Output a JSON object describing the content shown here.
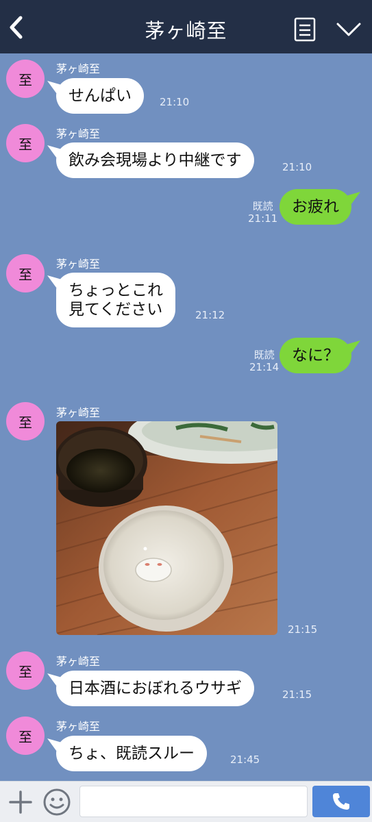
{
  "header": {
    "title": "茅ヶ崎至"
  },
  "messages": [
    {
      "avatar": "至",
      "name": "茅ヶ崎至",
      "text": "せんぱい",
      "time": "21:10"
    },
    {
      "avatar": "至",
      "name": "茅ヶ崎至",
      "text": "飲み会現場より中継です",
      "time": "21:10"
    },
    {
      "read": "既読",
      "text": "お疲れ",
      "time": "21:11"
    },
    {
      "avatar": "至",
      "name": "茅ヶ崎至",
      "text": "ちょっとこれ\n見てください",
      "time": "21:12"
    },
    {
      "read": "既読",
      "text": "なに？",
      "time": "21:14"
    },
    {
      "avatar": "至",
      "name": "茅ヶ崎至",
      "time": "21:15"
    },
    {
      "avatar": "至",
      "name": "茅ヶ崎至",
      "text": "日本酒におぼれるウサギ",
      "time": "21:15"
    },
    {
      "avatar": "至",
      "name": "茅ヶ崎至",
      "text": "ちょ、既読スルー",
      "time": "21:45"
    }
  ],
  "input": {
    "placeholder": ""
  },
  "colors": {
    "header_bg": "#232f46",
    "chat_bg": "#7190c0",
    "sent_bubble": "#7fd63a",
    "avatar": "#f08ad9",
    "send_button": "#4f85d8"
  },
  "icons": [
    "back-icon",
    "note-icon",
    "chevron-down-icon",
    "plus-icon",
    "emoji-icon",
    "phone-icon"
  ]
}
